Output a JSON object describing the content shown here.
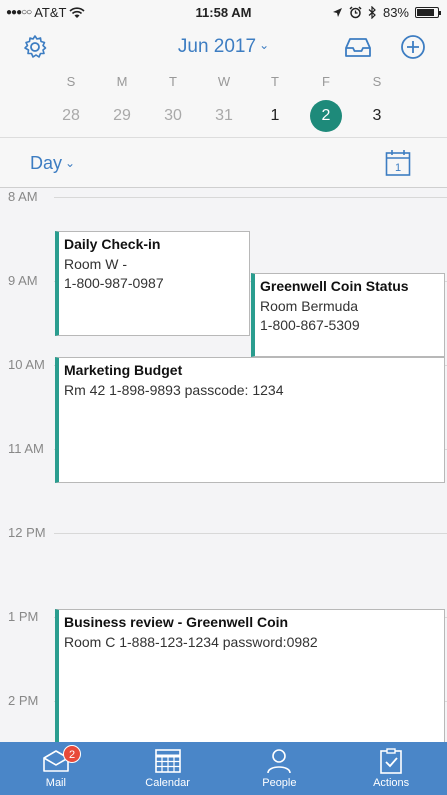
{
  "status_bar": {
    "carrier": "AT&T",
    "time": "11:58 AM",
    "battery": "83%"
  },
  "header": {
    "month_title": "Jun 2017"
  },
  "week": {
    "days": [
      {
        "dow": "S",
        "date": "28",
        "state": "past"
      },
      {
        "dow": "M",
        "date": "29",
        "state": "past"
      },
      {
        "dow": "T",
        "date": "30",
        "state": "past"
      },
      {
        "dow": "W",
        "date": "31",
        "state": "past"
      },
      {
        "dow": "T",
        "date": "1",
        "state": "current"
      },
      {
        "dow": "F",
        "date": "2",
        "state": "selected"
      },
      {
        "dow": "S",
        "date": "3",
        "state": "current"
      }
    ]
  },
  "view_bar": {
    "view_label": "Day",
    "today_icon_number": "1"
  },
  "timeline": {
    "hours": [
      "8 AM",
      "9 AM",
      "10 AM",
      "11 AM",
      "12 PM",
      "1 PM",
      "2 PM"
    ]
  },
  "events": [
    {
      "title": "Daily Check-in",
      "lines": [
        "Room W -",
        "1-800-987-0987"
      ]
    },
    {
      "title": "Greenwell Coin Status",
      "lines": [
        "Room Bermuda",
        "1-800-867-5309"
      ]
    },
    {
      "title": "Marketing Budget",
      "lines": [
        "Rm 42 1-898-9893 passcode: 1234"
      ]
    },
    {
      "title": "Business review - Greenwell Coin",
      "lines": [
        "Room C 1-888-123-1234  password:0982"
      ]
    }
  ],
  "tab_bar": {
    "tabs": [
      {
        "label": "Mail",
        "icon": "mail-icon",
        "badge": "2"
      },
      {
        "label": "Calendar",
        "icon": "calendar-icon"
      },
      {
        "label": "People",
        "icon": "people-icon"
      },
      {
        "label": "Actions",
        "icon": "actions-icon"
      }
    ]
  },
  "colors": {
    "accent": "#3d7dc2",
    "event_bar": "#2a9d8f",
    "selected_day": "#1e8a7a",
    "tab_bar": "#4a86c8",
    "badge": "#e84a3a"
  }
}
